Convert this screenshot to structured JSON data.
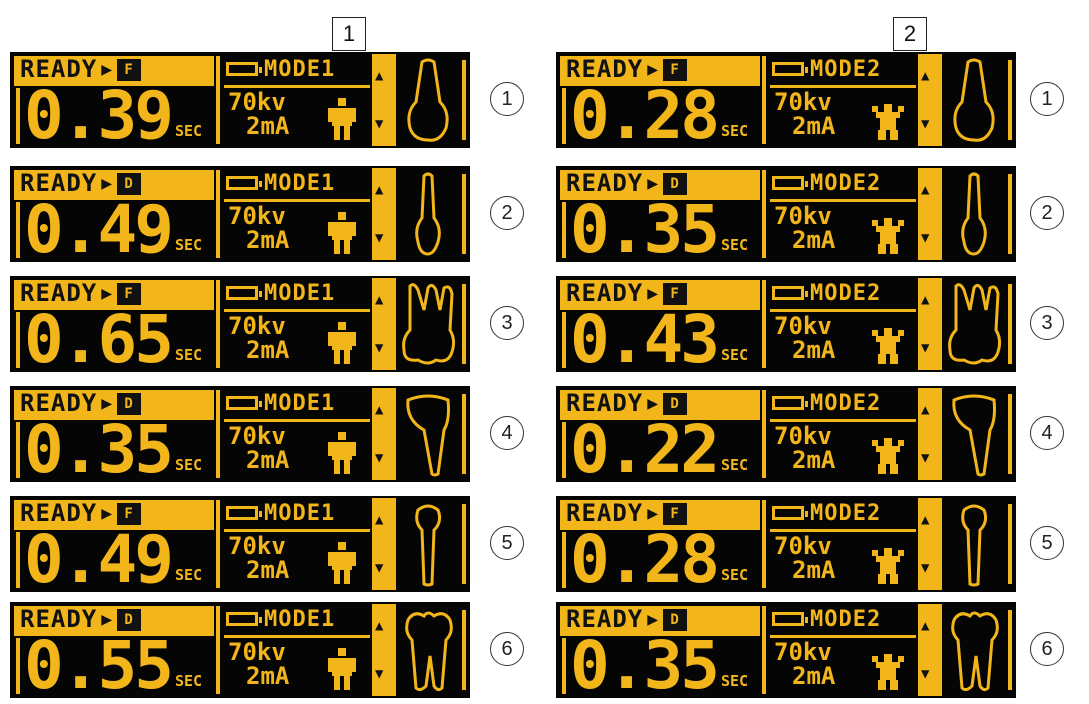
{
  "columns": [
    {
      "label": "1",
      "mode": "MODE1",
      "kv": "70kv",
      "ma": "2mA",
      "person": "adult",
      "rows": [
        {
          "num": "1",
          "ready": "READY",
          "flag": "F",
          "time": "0.39",
          "unit": "SEC",
          "tooth": "incisor"
        },
        {
          "num": "2",
          "ready": "READY",
          "flag": "D",
          "time": "0.49",
          "unit": "SEC",
          "tooth": "canine"
        },
        {
          "num": "3",
          "ready": "READY",
          "flag": "F",
          "time": "0.65",
          "unit": "SEC",
          "tooth": "upper-molar"
        },
        {
          "num": "4",
          "ready": "READY",
          "flag": "D",
          "time": "0.35",
          "unit": "SEC",
          "tooth": "lower-incisor"
        },
        {
          "num": "5",
          "ready": "READY",
          "flag": "F",
          "time": "0.49",
          "unit": "SEC",
          "tooth": "premolar"
        },
        {
          "num": "6",
          "ready": "READY",
          "flag": "D",
          "time": "0.55",
          "unit": "SEC",
          "tooth": "lower-molar"
        }
      ]
    },
    {
      "label": "2",
      "mode": "MODE2",
      "kv": "70kv",
      "ma": "2mA",
      "person": "child",
      "rows": [
        {
          "num": "1",
          "ready": "READY",
          "flag": "F",
          "time": "0.28",
          "unit": "SEC",
          "tooth": "incisor"
        },
        {
          "num": "2",
          "ready": "READY",
          "flag": "D",
          "time": "0.35",
          "unit": "SEC",
          "tooth": "canine"
        },
        {
          "num": "3",
          "ready": "READY",
          "flag": "F",
          "time": "0.43",
          "unit": "SEC",
          "tooth": "upper-molar"
        },
        {
          "num": "4",
          "ready": "READY",
          "flag": "D",
          "time": "0.22",
          "unit": "SEC",
          "tooth": "lower-incisor"
        },
        {
          "num": "5",
          "ready": "READY",
          "flag": "F",
          "time": "0.28",
          "unit": "SEC",
          "tooth": "premolar"
        },
        {
          "num": "6",
          "ready": "READY",
          "flag": "D",
          "time": "0.35",
          "unit": "SEC",
          "tooth": "lower-molar"
        }
      ]
    }
  ],
  "colors": {
    "lcd_background": "#050505",
    "lcd_amber": "#f2b61a"
  },
  "icons": {
    "battery": "battery-icon",
    "up": "up-arrow-icon",
    "down": "down-arrow-icon"
  }
}
